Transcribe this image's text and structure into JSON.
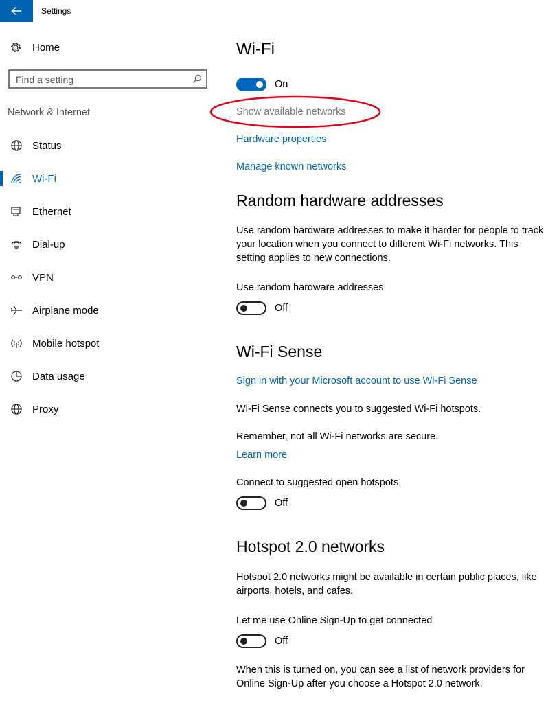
{
  "window": {
    "title": "Settings"
  },
  "sidebar": {
    "home_label": "Home",
    "search_placeholder": "Find a setting",
    "section_header": "Network & Internet",
    "items": [
      {
        "label": "Status",
        "icon": "globe-icon"
      },
      {
        "label": "Wi-Fi",
        "icon": "wifi-icon",
        "selected": true
      },
      {
        "label": "Ethernet",
        "icon": "ethernet-icon"
      },
      {
        "label": "Dial-up",
        "icon": "dialup-icon"
      },
      {
        "label": "VPN",
        "icon": "vpn-icon"
      },
      {
        "label": "Airplane mode",
        "icon": "airplane-icon"
      },
      {
        "label": "Mobile hotspot",
        "icon": "hotspot-icon"
      },
      {
        "label": "Data usage",
        "icon": "data-usage-icon"
      },
      {
        "label": "Proxy",
        "icon": "globe-icon"
      }
    ]
  },
  "main": {
    "wifi": {
      "title": "Wi-Fi",
      "toggle_state": "On",
      "show_networks": "Show available networks",
      "hardware_properties": "Hardware properties",
      "manage_known": "Manage known networks"
    },
    "random_hw": {
      "title": "Random hardware addresses",
      "description": "Use random hardware addresses to make it harder for people to track your location when you connect to different Wi-Fi networks. This setting applies to new connections.",
      "setting_label": "Use random hardware addresses",
      "toggle_state": "Off"
    },
    "wifi_sense": {
      "title": "Wi-Fi Sense",
      "signin_link": "Sign in with your Microsoft account to use Wi-Fi Sense",
      "description": "Wi-Fi Sense connects you to suggested Wi-Fi hotspots.",
      "warning": "Remember, not all Wi-Fi networks are secure.",
      "learn_more": "Learn more",
      "setting_label": "Connect to suggested open hotspots",
      "toggle_state": "Off"
    },
    "hotspot20": {
      "title": "Hotspot 2.0 networks",
      "description": "Hotspot 2.0 networks might be available in certain public places, like airports, hotels, and cafes.",
      "setting_label": "Let me use Online Sign-Up to get connected",
      "toggle_state": "Off",
      "footer": "When this is turned on, you can see a list of network providers for Online Sign-Up after you choose a Hotspot 2.0 network."
    }
  },
  "colors": {
    "accent": "#0063b1",
    "link": "#0067b8",
    "annotation": "#e0001b"
  }
}
